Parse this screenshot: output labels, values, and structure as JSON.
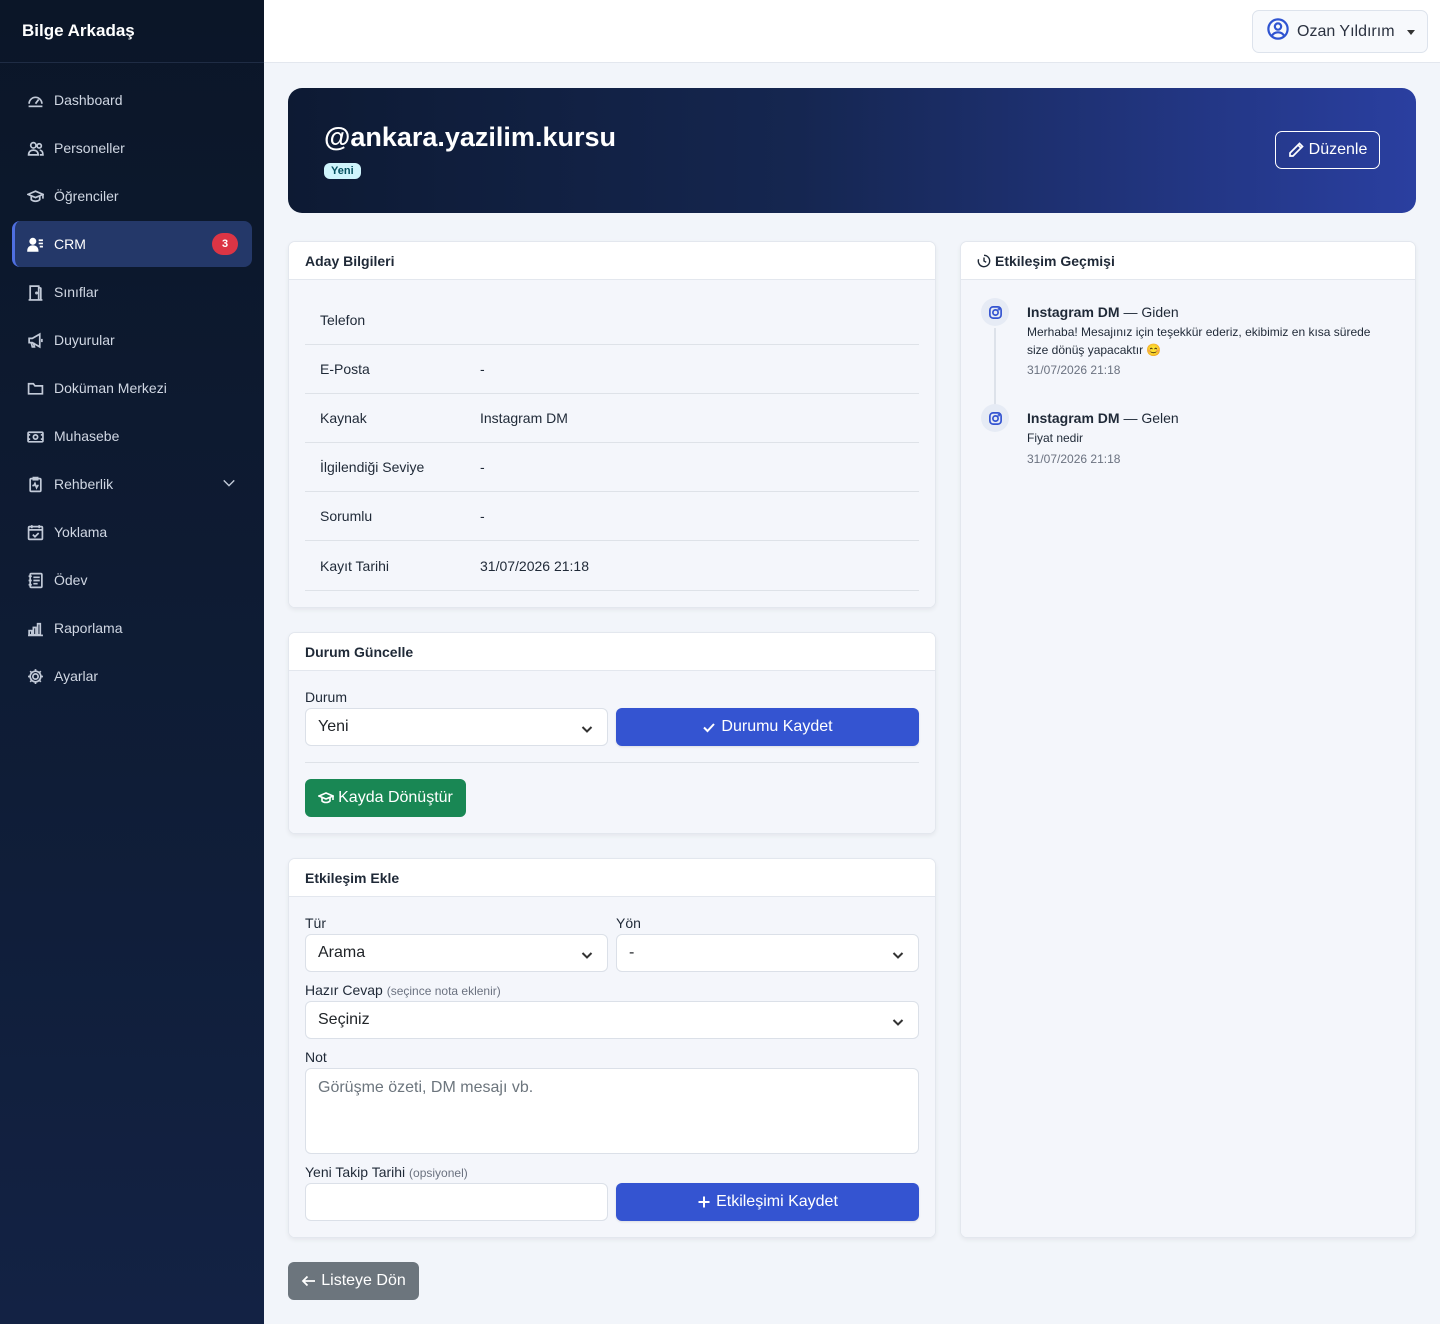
{
  "app": {
    "brand": "Bilge Arkadaş"
  },
  "sidebar": {
    "items": [
      {
        "label": "Dashboard",
        "icon": "dashboard-icon"
      },
      {
        "label": "Personeller",
        "icon": "users-icon"
      },
      {
        "label": "Öğrenciler",
        "icon": "graduation-cap-icon"
      },
      {
        "label": "CRM",
        "icon": "person-lines-icon",
        "active": true,
        "badge": "3"
      },
      {
        "label": "Sınıflar",
        "icon": "door-icon"
      },
      {
        "label": "Duyurular",
        "icon": "megaphone-icon"
      },
      {
        "label": "Doküman Merkezi",
        "icon": "folder-icon"
      },
      {
        "label": "Muhasebe",
        "icon": "cash-icon"
      },
      {
        "label": "Rehberlik",
        "icon": "clipboard-pulse-icon",
        "has_submenu": true
      },
      {
        "label": "Yoklama",
        "icon": "calendar-check-icon"
      },
      {
        "label": "Ödev",
        "icon": "journal-icon"
      },
      {
        "label": "Raporlama",
        "icon": "bar-chart-icon"
      },
      {
        "label": "Ayarlar",
        "icon": "gear-icon"
      }
    ]
  },
  "topbar": {
    "user_name": "Ozan Yıldırım"
  },
  "hero": {
    "title": "@ankara.yazilim.kursu",
    "status_badge": "Yeni",
    "edit_label": "Düzenle"
  },
  "candidate": {
    "title": "Aday Bilgileri",
    "rows": [
      {
        "key": "Telefon",
        "value": ""
      },
      {
        "key": "E-Posta",
        "value": "-"
      },
      {
        "key": "Kaynak",
        "value": "Instagram DM"
      },
      {
        "key": "İlgilendiği Seviye",
        "value": "-"
      },
      {
        "key": "Sorumlu",
        "value": "-"
      },
      {
        "key": "Kayıt Tarihi",
        "value": "31/07/2026 21:18"
      }
    ]
  },
  "status_update": {
    "title": "Durum Güncelle",
    "status_label": "Durum",
    "status_value": "Yeni",
    "save_label": "Durumu Kaydet",
    "convert_label": "Kayda Dönüştür"
  },
  "interaction_add": {
    "title": "Etkileşim Ekle",
    "type_label": "Tür",
    "type_value": "Arama",
    "direction_label": "Yön",
    "direction_value": "-",
    "template_label": "Hazır Cevap",
    "template_hint": "(seçince nota eklenir)",
    "template_value": "Seçiniz",
    "note_label": "Not",
    "note_placeholder": "Görüşme özeti, DM mesajı vb.",
    "followup_label": "Yeni Takip Tarihi",
    "followup_hint": "(opsiyonel)",
    "followup_value": "",
    "save_label": "Etkileşimi Kaydet"
  },
  "history": {
    "title": "Etkileşim Geçmişi",
    "items": [
      {
        "channel": "Instagram DM",
        "direction": "— Giden",
        "text": "Merhaba! Mesajınız için teşekkür ederiz, ekibimiz en kısa sürede size dönüş yapacaktır 😊",
        "time": "31/07/2026 21:18",
        "icon": "instagram-icon"
      },
      {
        "channel": "Instagram DM",
        "direction": "— Gelen",
        "text": "Fiyat nedir",
        "time": "31/07/2026 21:18",
        "icon": "instagram-icon"
      }
    ]
  },
  "footer": {
    "back_label": "Listeye Dön"
  },
  "colors": {
    "primary": "#3454d1",
    "success": "#198754",
    "danger": "#dc3545",
    "secondary": "#6c757d",
    "sidebar": "#0f1d37"
  }
}
